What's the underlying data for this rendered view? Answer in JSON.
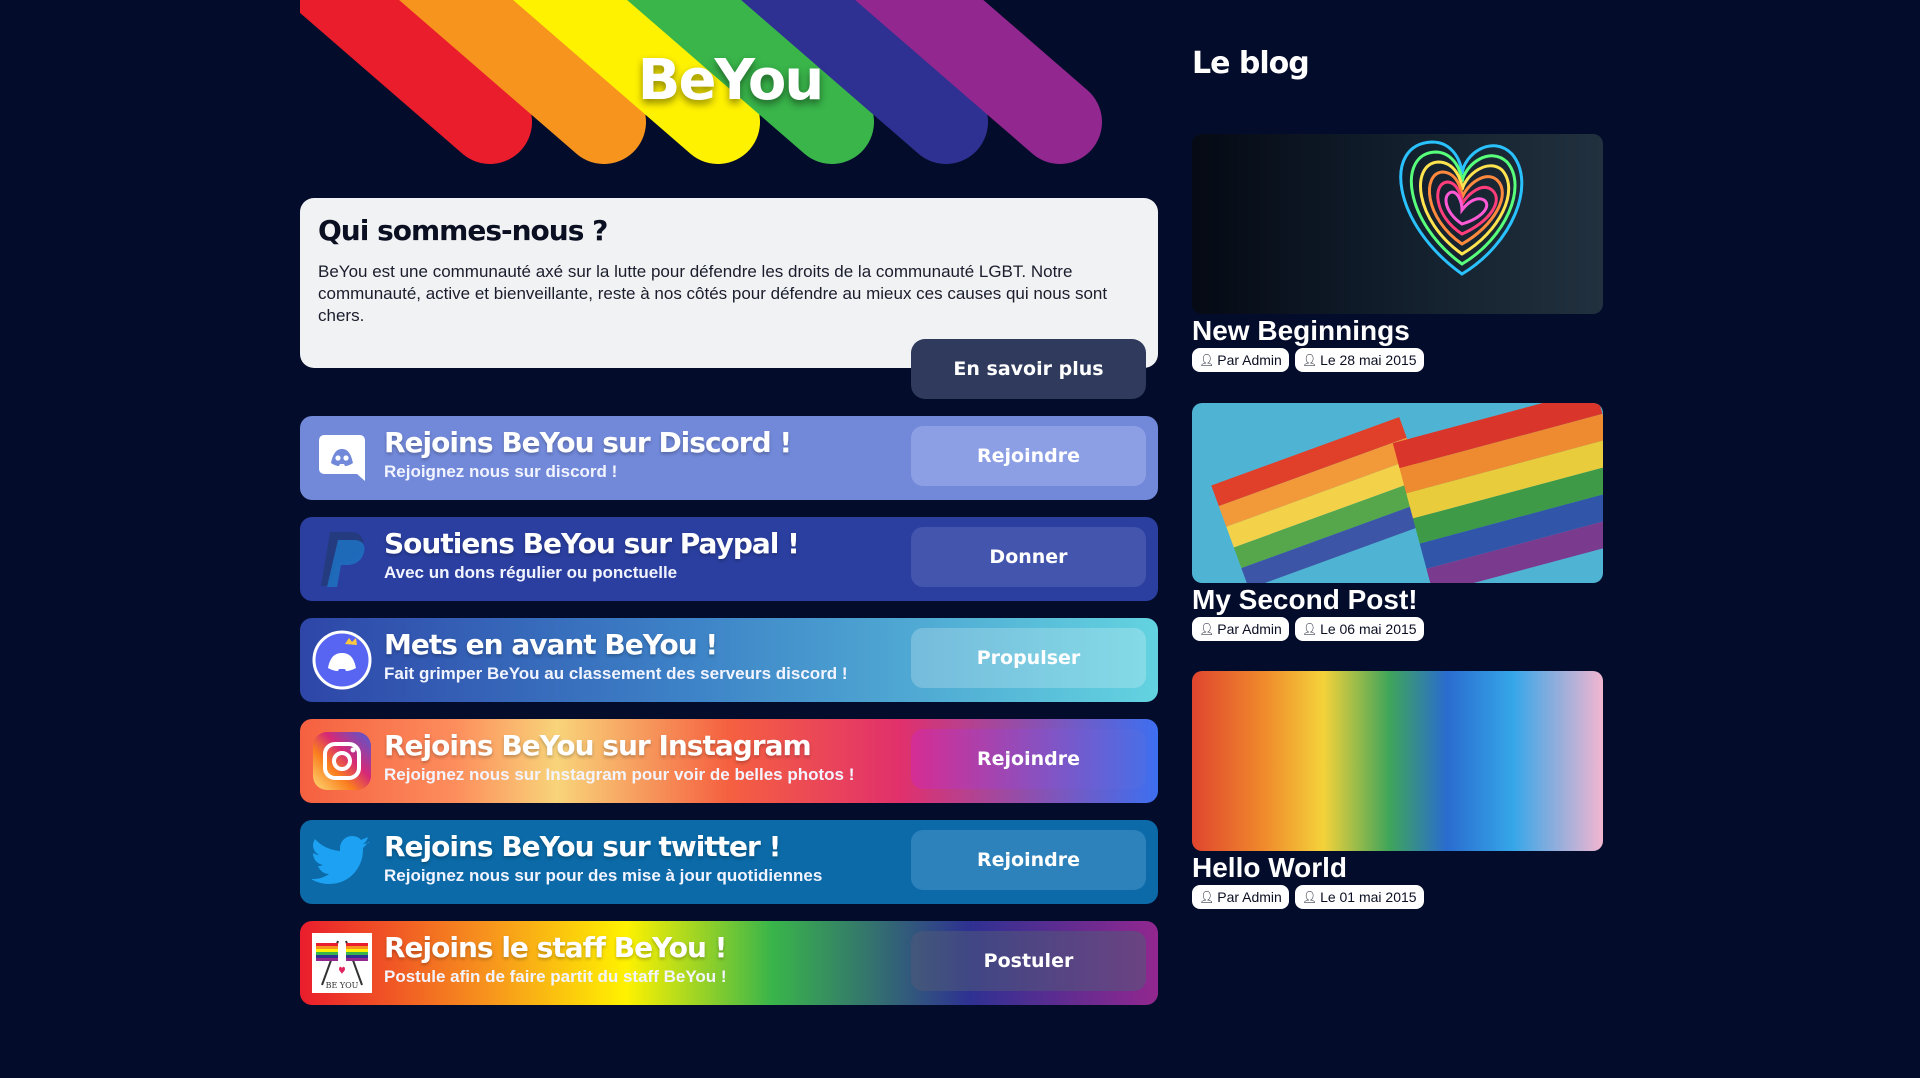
{
  "site": {
    "title": "BeYou"
  },
  "about": {
    "heading": "Qui sommes-nous ?",
    "text": "BeYou est une communauté axé sur la lutte pour défendre les droits de la communauté LGBT. Notre communauté, active et bienveillante, reste à nos côtés pour défendre au mieux ces causes qui nous sont chers.",
    "button": "En savoir plus"
  },
  "cards": [
    {
      "title": "Rejoins BeYou sur Discord !",
      "subtitle": "Rejoignez nous sur discord !",
      "button": "Rejoindre",
      "icon": "discord-icon"
    },
    {
      "title": "Soutiens BeYou sur Paypal !",
      "subtitle": "Avec un dons régulier ou ponctuelle",
      "button": "Donner",
      "icon": "paypal-icon"
    },
    {
      "title": "Mets en avant BeYou !",
      "subtitle": "Fait grimper BeYou au classement des serveurs discord !",
      "button": "Propulser",
      "icon": "discord-nitro-icon"
    },
    {
      "title": "Rejoins BeYou sur Instagram",
      "subtitle": "Rejoignez nous sur Instagram pour voir de belles photos !",
      "button": "Rejoindre",
      "icon": "instagram-icon"
    },
    {
      "title": "Rejoins BeYou sur twitter !",
      "subtitle": "Rejoignez nous sur pour des mise à jour quotidiennes",
      "button": "Rejoindre",
      "icon": "twitter-icon"
    },
    {
      "title": "Rejoins le staff BeYou !",
      "subtitle": "Postule afin de faire partit du staff BeYou !",
      "button": "Postuler",
      "icon": "beyou-logo-icon",
      "icon_text": "BE YOU"
    }
  ],
  "blog": {
    "heading": "Le blog",
    "posts": [
      {
        "title": "New Beginnings",
        "author": "Par Admin",
        "date": "Le 28 mai 2015"
      },
      {
        "title": "My Second Post!",
        "author": "Par Admin",
        "date": "Le 06 mai 2015"
      },
      {
        "title": "Hello World",
        "author": "Par Admin",
        "date": "Le 01 mai 2015"
      }
    ]
  },
  "colors": {
    "background": "#040c2b",
    "rainbow": [
      "#ea1d2c",
      "#f7941d",
      "#fff200",
      "#39b54a",
      "#2e3192",
      "#92278f"
    ]
  }
}
